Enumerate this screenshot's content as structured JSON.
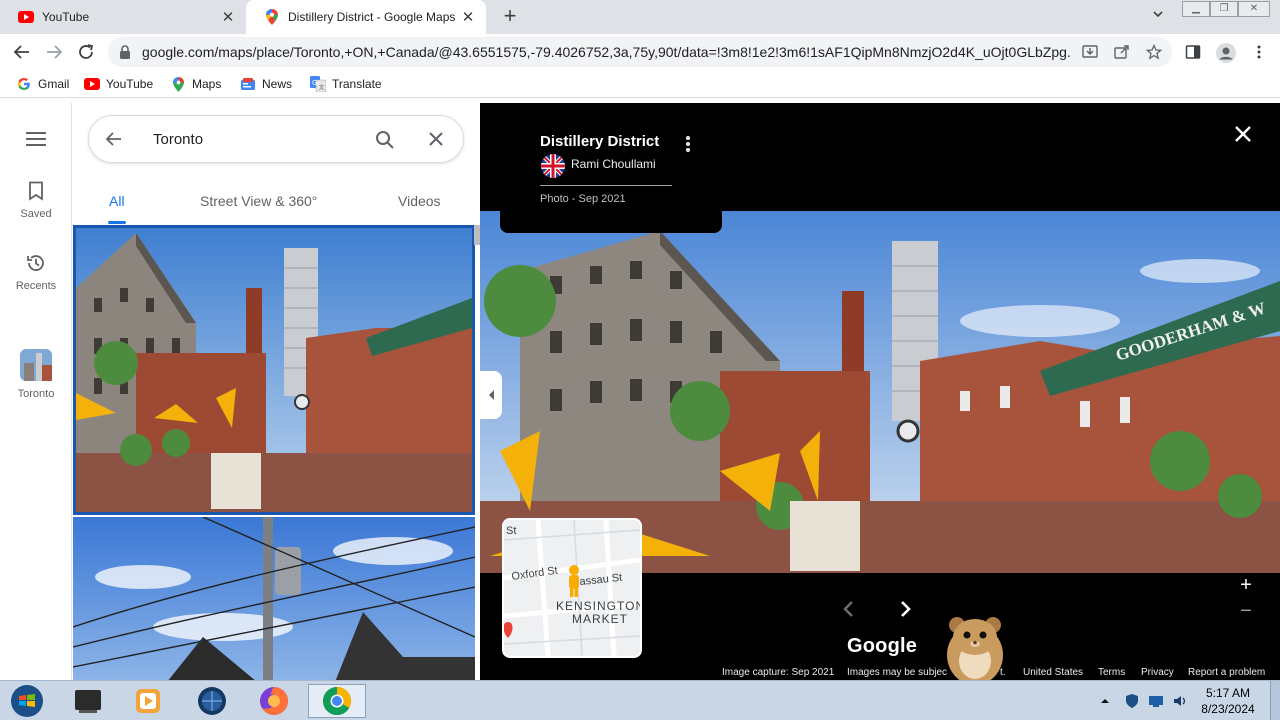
{
  "browser": {
    "tabs": [
      {
        "title": "YouTube",
        "close": "✕"
      },
      {
        "title": "Distillery District - Google Maps",
        "close": "✕"
      }
    ],
    "new_tab": "+",
    "url": "google.com/maps/place/Toronto,+ON,+Canada/@43.6551575,-79.4026752,3a,75y,90t/data=!3m8!1e2!3m6!1sAF1QipMn8NmzjO2d4K_uOjt0GLbZpg..."
  },
  "bookmarks": [
    "Gmail",
    "YouTube",
    "Maps",
    "News",
    "Translate"
  ],
  "rail": {
    "saved": "Saved",
    "recents": "Recents",
    "toronto": "Toronto"
  },
  "search": {
    "query": "Toronto",
    "tabs": [
      "All",
      "Street View & 360°",
      "Videos"
    ]
  },
  "viewer": {
    "place": "Distillery District",
    "author": "Rami Choullami",
    "date": "Photo - Sep 2021",
    "sign_text": "GOODERHAM & W",
    "logo": "Google",
    "minimap": {
      "streets": [
        "Oxford St",
        "Nassau St"
      ],
      "area": [
        "KENSINGTON",
        "MARKET"
      ],
      "top_label": "St"
    },
    "footer": {
      "capture": "Image capture: Sep 2021",
      "notice": "Images may be subjec",
      "suffix": "t.",
      "region": "United States",
      "terms": "Terms",
      "privacy": "Privacy",
      "report": "Report a problem"
    }
  },
  "taskbar": {
    "time": "5:17 AM",
    "date": "8/23/2024"
  },
  "colors": {
    "accent": "#1a73e8",
    "tab_strip": "#dee1e6",
    "viewer_bg": "#000000",
    "taskbar": "#c9d6e6"
  }
}
